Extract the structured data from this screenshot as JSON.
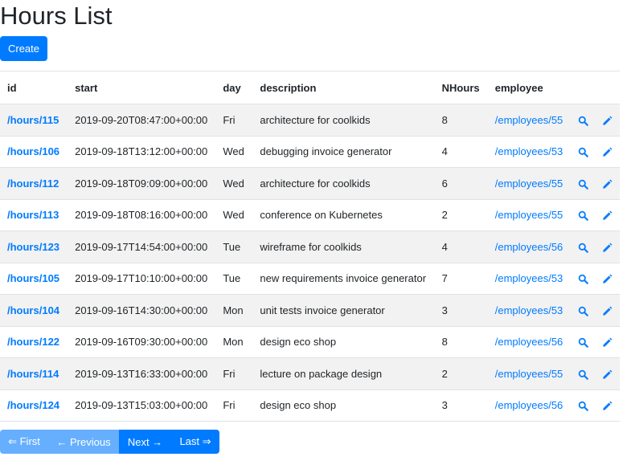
{
  "page": {
    "title": "Hours List",
    "create_label": "Create"
  },
  "columns": [
    "id",
    "start",
    "day",
    "description",
    "NHours",
    "employee"
  ],
  "rows": [
    {
      "id": "/hours/115",
      "start": "2019-09-20T08:47:00+00:00",
      "day": "Fri",
      "description": "architecture for coolkids",
      "nhours": "8",
      "employee": "/employees/55"
    },
    {
      "id": "/hours/106",
      "start": "2019-09-18T13:12:00+00:00",
      "day": "Wed",
      "description": "debugging invoice generator",
      "nhours": "4",
      "employee": "/employees/53"
    },
    {
      "id": "/hours/112",
      "start": "2019-09-18T09:09:00+00:00",
      "day": "Wed",
      "description": "architecture for coolkids",
      "nhours": "6",
      "employee": "/employees/55"
    },
    {
      "id": "/hours/113",
      "start": "2019-09-18T08:16:00+00:00",
      "day": "Wed",
      "description": "conference on Kubernetes",
      "nhours": "2",
      "employee": "/employees/55"
    },
    {
      "id": "/hours/123",
      "start": "2019-09-17T14:54:00+00:00",
      "day": "Tue",
      "description": "wireframe for coolkids",
      "nhours": "4",
      "employee": "/employees/56"
    },
    {
      "id": "/hours/105",
      "start": "2019-09-17T10:10:00+00:00",
      "day": "Tue",
      "description": "new requirements invoice generator",
      "nhours": "7",
      "employee": "/employees/53"
    },
    {
      "id": "/hours/104",
      "start": "2019-09-16T14:30:00+00:00",
      "day": "Mon",
      "description": "unit tests invoice generator",
      "nhours": "3",
      "employee": "/employees/53"
    },
    {
      "id": "/hours/122",
      "start": "2019-09-16T09:30:00+00:00",
      "day": "Mon",
      "description": "design eco shop",
      "nhours": "8",
      "employee": "/employees/56"
    },
    {
      "id": "/hours/114",
      "start": "2019-09-13T16:33:00+00:00",
      "day": "Fri",
      "description": "lecture on package design",
      "nhours": "2",
      "employee": "/employees/55"
    },
    {
      "id": "/hours/124",
      "start": "2019-09-13T15:03:00+00:00",
      "day": "Fri",
      "description": "design eco shop",
      "nhours": "3",
      "employee": "/employees/56"
    }
  ],
  "row_icons": {
    "view": "search-icon",
    "edit": "pencil-icon"
  },
  "pagination": {
    "first": "⇐ First",
    "previous": "← Previous",
    "next": "Next →",
    "last": "Last ⇒"
  },
  "colors": {
    "primary": "#007bff",
    "primary_disabled": "#66afff",
    "stripe": "#f2f2f2",
    "text": "#212529"
  }
}
